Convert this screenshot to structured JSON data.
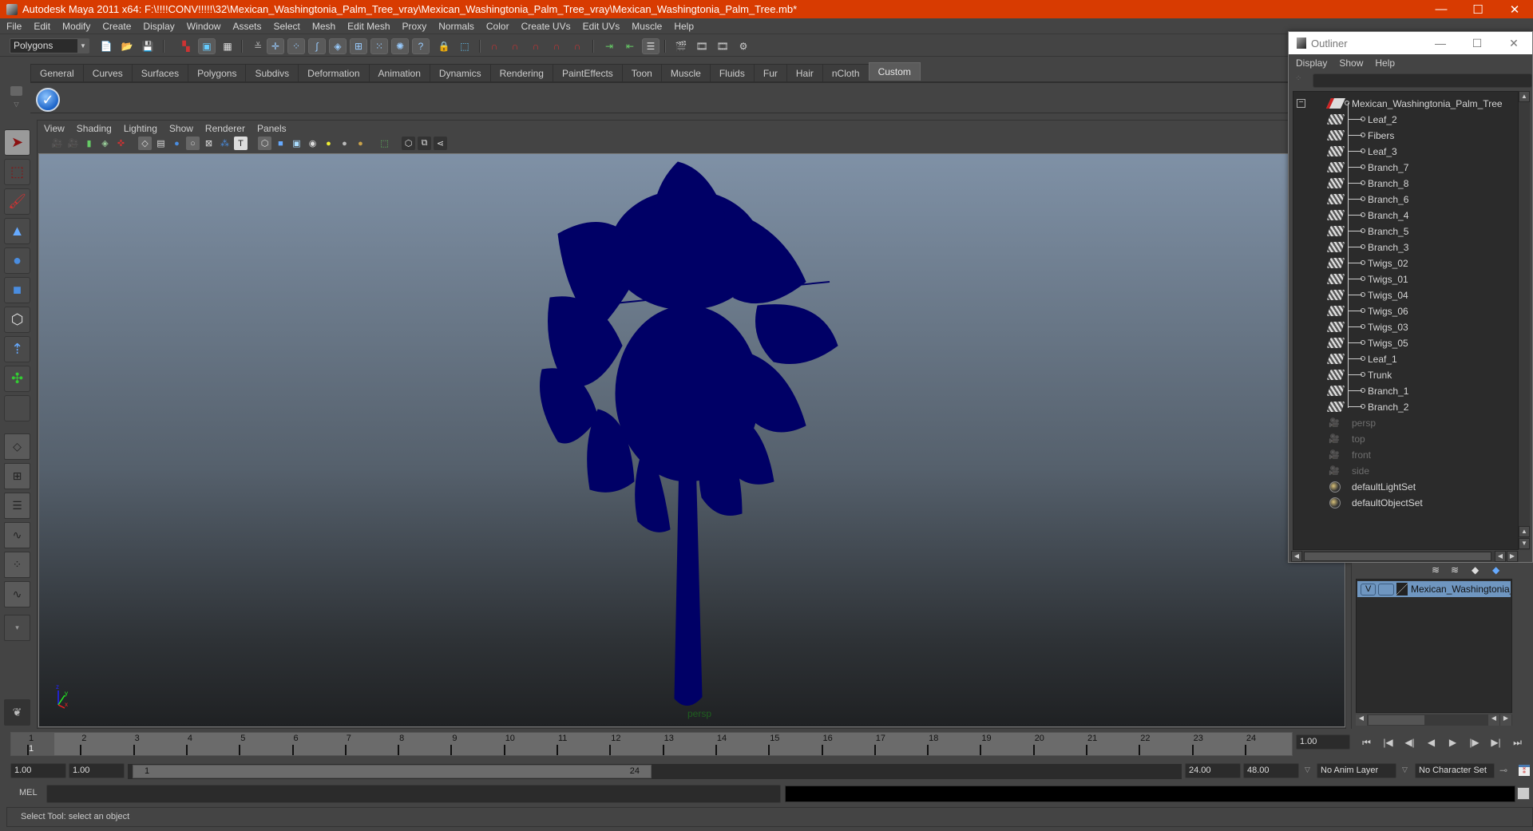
{
  "window": {
    "title": "Autodesk Maya 2011 x64: F:\\!!!!CONV!!!!!\\32\\Mexican_Washingtonia_Palm_Tree_vray\\Mexican_Washingtonia_Palm_Tree_vray\\Mexican_Washingtonia_Palm_Tree.mb*",
    "minimize": "—",
    "maximize": "☐",
    "close": "✕"
  },
  "menubar": [
    "File",
    "Edit",
    "Modify",
    "Create",
    "Display",
    "Window",
    "Assets",
    "Select",
    "Mesh",
    "Edit Mesh",
    "Proxy",
    "Normals",
    "Color",
    "Create UVs",
    "Edit UVs",
    "Muscle",
    "Help"
  ],
  "statusline": {
    "mode": "Polygons",
    "icons": [
      "new-scene",
      "open-scene",
      "save-scene",
      "select-hierarchy",
      "select-object",
      "select-component",
      "snap-toggle",
      "snap-grid",
      "snap-curve",
      "snap-point",
      "snap-view-plane",
      "snap-live",
      "snap-vertex",
      "snap-edge",
      "help-query",
      "lock-selection",
      "highlight-selection",
      "history",
      "construction-history",
      "input-ops",
      "output-ops",
      "make-live",
      "show-inputs",
      "show-outputs",
      "attribute-editor",
      "render-frame",
      "ipr-render",
      "render-settings",
      "hypershade"
    ]
  },
  "shelf": {
    "tabs": [
      "General",
      "Curves",
      "Surfaces",
      "Polygons",
      "Subdivs",
      "Deformation",
      "Animation",
      "Dynamics",
      "Rendering",
      "PaintEffects",
      "Toon",
      "Muscle",
      "Fluids",
      "Fur",
      "Hair",
      "nCloth",
      "Custom"
    ],
    "active_tab": "Custom",
    "items": [
      "checkmark-script"
    ]
  },
  "toolbox": {
    "tools": [
      "select-tool",
      "lasso-tool",
      "paint-select-tool",
      "move-tool",
      "rotate-tool",
      "scale-tool",
      "universal-manip",
      "soft-mod-tool",
      "show-manip-tool",
      "last-tool"
    ],
    "layouts": [
      "single-pane",
      "four-pane",
      "outliner-persp",
      "persp-graph",
      "hypershade-persp",
      "persp-graph-hypergraph"
    ]
  },
  "panel": {
    "menus": [
      "View",
      "Shading",
      "Lighting",
      "Show",
      "Renderer",
      "Panels"
    ],
    "camera_label": "persp",
    "axis": {
      "x": "x",
      "y": "y",
      "z": "z"
    }
  },
  "viewport": {
    "object_color": "#000066",
    "background_top": "#7f91a6",
    "background_bottom": "#1f2123"
  },
  "outliner": {
    "title": "Outliner",
    "menus": [
      "Display",
      "Show",
      "Help"
    ],
    "filter_value": "",
    "root": "Mexican_Washingtonia_Palm_Tree",
    "children": [
      "Leaf_2",
      "Fibers",
      "Leaf_3",
      "Branch_7",
      "Branch_8",
      "Branch_6",
      "Branch_4",
      "Branch_5",
      "Branch_3",
      "Twigs_02",
      "Twigs_01",
      "Twigs_04",
      "Twigs_06",
      "Twigs_03",
      "Twigs_05",
      "Leaf_1",
      "Trunk",
      "Branch_1",
      "Branch_2"
    ],
    "cameras": [
      "persp",
      "top",
      "front",
      "side"
    ],
    "sets": [
      "defaultLightSet",
      "defaultObjectSet"
    ]
  },
  "layer_editor": {
    "layers": [
      {
        "visible": "V",
        "playback": "",
        "name": "Mexican_Washingtonia_P",
        "selected": true
      }
    ]
  },
  "timeslider": {
    "ticks": [
      "1",
      "2",
      "3",
      "4",
      "5",
      "6",
      "7",
      "8",
      "9",
      "10",
      "11",
      "12",
      "13",
      "14",
      "15",
      "16",
      "17",
      "18",
      "19",
      "20",
      "21",
      "22",
      "23",
      "24"
    ],
    "current_label": "1",
    "current_frame": "1.00",
    "playback": [
      "go-to-start",
      "step-back-key",
      "step-back-frame",
      "play-backward",
      "play-forward",
      "step-forward-frame",
      "step-forward-key",
      "go-to-end"
    ],
    "playback_glyphs": [
      "⏮",
      "|◀",
      "◀|",
      "◀",
      "▶",
      "|▶",
      "▶|",
      "⏭"
    ]
  },
  "rangeslider": {
    "start_time": "1.00",
    "playback_start": "1.00",
    "range_start": "1",
    "range_end": "24",
    "playback_end": "24.00",
    "end_time": "48.00",
    "anim_layer": "No Anim Layer",
    "character_set": "No Character Set"
  },
  "cmdline": {
    "label": "MEL",
    "value": ""
  },
  "helpline": {
    "text": "Select Tool: select an object"
  }
}
